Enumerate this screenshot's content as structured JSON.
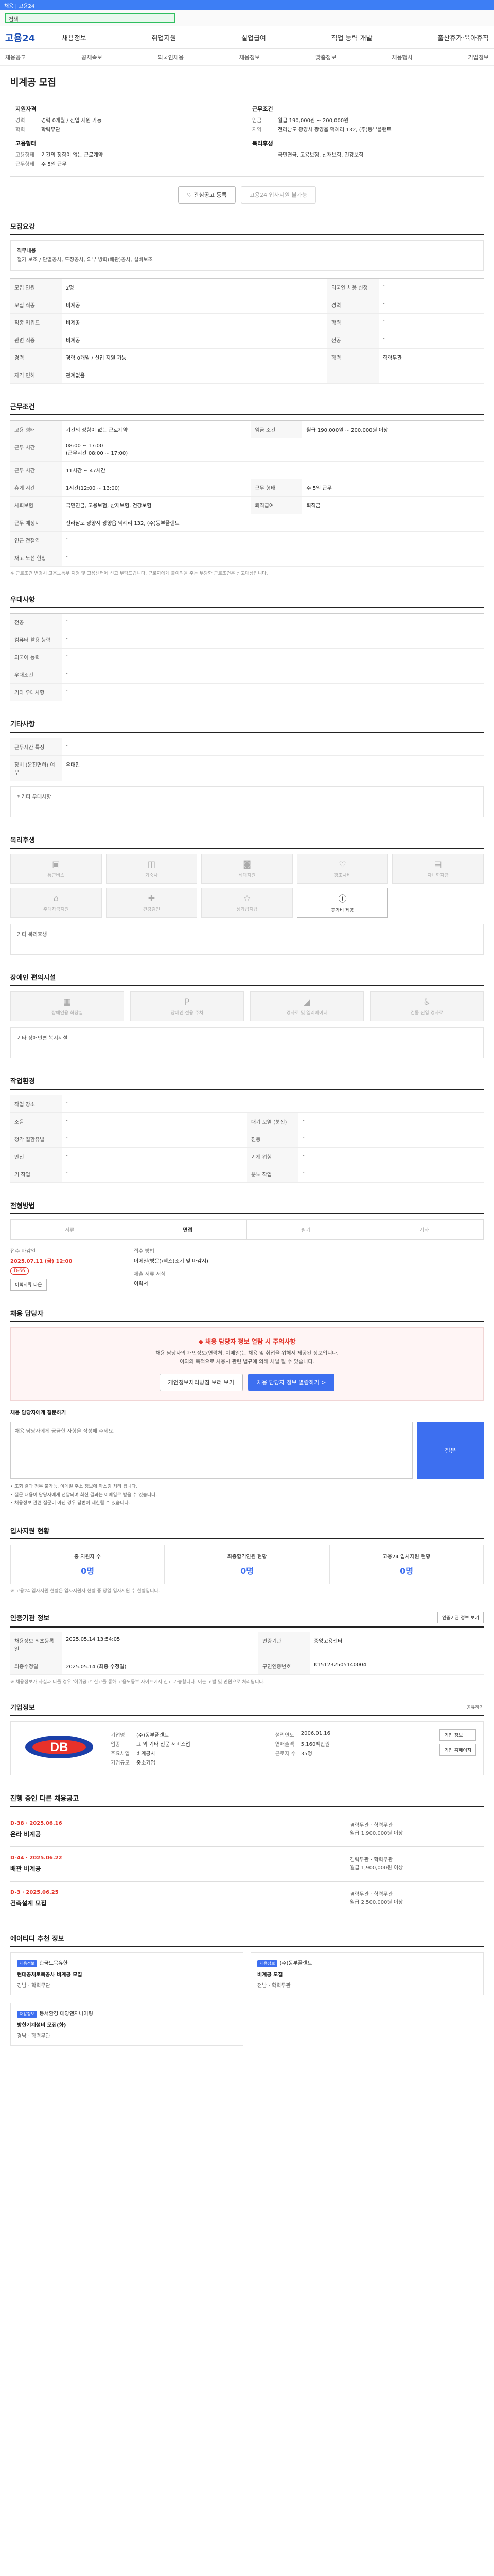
{
  "topbar": {
    "text": "채용 | 고용24"
  },
  "search": {
    "value": "검색"
  },
  "header": {
    "logo": "고용24",
    "menu": [
      "채용정보",
      "취업지원",
      "실업급여",
      "직업 능력 개발",
      "출산휴가·육아휴직"
    ]
  },
  "subnav": [
    "채용공고",
    "공채속보",
    "외국인채용",
    "채용정보",
    "맞춤정보",
    "채용행사",
    "기업정보"
  ],
  "job_title": "비계공 모집",
  "summary": {
    "left_label": "지원자격",
    "left_rows": [
      {
        "k": "경력",
        "v": "경력 0개월 / 신입 지원 가능"
      },
      {
        "k": "학력",
        "v": "학력무관"
      }
    ],
    "left_label2": "고용형태",
    "left_rows2": [
      {
        "k": "고용형태",
        "v": "기간의 정함이 없는 근로계약"
      },
      {
        "k": "근무형태",
        "v": "주 5일 근무"
      }
    ],
    "right_label": "근무조건",
    "right_rows": [
      {
        "k": "임금",
        "v": "월급 190,000원 ~ 200,000원"
      },
      {
        "k": "지역",
        "v": "전라남도 광양시 광양읍 덕례리 132, (주)동부플랜트"
      }
    ],
    "right_label2": "복리후생",
    "right_rows2": [
      {
        "k": "",
        "v": "국민연금, 고용보험, 산재보험, 건강보험"
      }
    ]
  },
  "buttons": {
    "interest": "♡ 관심공고 등록",
    "apply": "고용24 입사지원 불가능"
  },
  "sections": {
    "recruit": "모집요강",
    "conditions": "근무조건",
    "preference": "우대사항",
    "etc": "기타사항",
    "welfare": "복리후생",
    "disability": "장애인 편의시설",
    "environment": "작업환경",
    "method": "전형방법",
    "contact": "채용 담당자",
    "applicants": "입사지원 현황",
    "agency": "인증기관 정보",
    "company": "기업정보",
    "other_jobs": "진행 중인 다른 채용공고",
    "recommend": "에이티디 추천 정보"
  },
  "recruit_box": {
    "label": "직무내용",
    "text": "철거 보조 / 단열공사, 도장공사, 외부 방화(배관)공사, 설비보조"
  },
  "recruit_table": [
    {
      "h": "모집 인원",
      "v": "2명",
      "h2": "외국인 채용 신청",
      "v2": "-"
    },
    {
      "h": "모집 직종",
      "v": "비계공",
      "h2": "경력",
      "v2": "-"
    },
    {
      "h": "직종 키워드",
      "v": "비계공",
      "h2": "학력",
      "v2": "-"
    },
    {
      "h": "관련 직종",
      "v": "비계공",
      "h2": "전공",
      "v2": "-"
    },
    {
      "h": "경력",
      "v": "경력 0개월 / 신입 지원 가능",
      "h2": "학력",
      "v2": "학력무관"
    },
    {
      "h": "자격 면허",
      "v": "관계없음",
      "h2": "",
      "v2": ""
    }
  ],
  "cond_table": [
    {
      "h": "고용 형태",
      "v": "기간의 정함이 없는 근로계약",
      "h2": "임금 조건",
      "v2": "월급 190,000원 ~ 200,000원 이상"
    },
    {
      "h": "근무 시간",
      "v": "08:00 ~ 17:00\n(근무시간 08:00 ~ 17:00)"
    },
    {
      "h": "근무 시간",
      "v": "11시간 ~ 47시간"
    },
    {
      "h": "휴게 시간",
      "v": "1시간(12:00 ~ 13:00)",
      "h2": "근무 형태",
      "v2": "주 5일 근무"
    },
    {
      "h": "사회보험",
      "v": "국민연금, 고용보험, 산재보험, 건강보험",
      "h2": "퇴직급여",
      "v2": "퇴직금"
    },
    {
      "h": "근무 예정지",
      "v": "전라남도 광양시 광양읍 덕례리 132, (주)동부플랜트",
      "h2": "",
      "v2": ""
    },
    {
      "h": "인근 전철역",
      "v": "-",
      "h2": "",
      "v2": ""
    },
    {
      "h": "재고 노선 현황",
      "v": "-",
      "h2": "",
      "v2": ""
    }
  ],
  "cond_note": "※ 근로조건 변경시 고용노동부 지청 및 고용센터에 신고 부탁드립니다. 근로자에게 불이익을 주는 부당한 근로조건은 신고대상입니다.",
  "pref_table": [
    {
      "h": "전공",
      "v": "-"
    },
    {
      "h": "컴퓨터 활용 능력",
      "v": "-"
    },
    {
      "h": "외국어 능력",
      "v": "-"
    },
    {
      "h": "우대조건",
      "v": "-"
    },
    {
      "h": "기타 우대사항",
      "v": "-"
    }
  ],
  "etc_table": [
    {
      "h": "근무시간 특징",
      "v": "-"
    },
    {
      "h": "장비 (운전면허) 여부",
      "v": "우대안"
    }
  ],
  "etc_box": "* 기타 우대사항",
  "welfare_items": [
    {
      "icon": "briefcase-icon",
      "glyph": "▣",
      "label": "통근버스",
      "on": false
    },
    {
      "icon": "car-icon",
      "glyph": "◫",
      "label": "기숙사",
      "on": false
    },
    {
      "icon": "meal-icon",
      "glyph": "◙",
      "label": "식대지원",
      "on": false
    },
    {
      "icon": "heart-icon",
      "glyph": "♡",
      "label": "경조사비",
      "on": false
    },
    {
      "icon": "gift-icon",
      "glyph": "▤",
      "label": "자녀학자금",
      "on": false
    },
    {
      "icon": "home-icon",
      "glyph": "⌂",
      "label": "주택자금지원",
      "on": false
    },
    {
      "icon": "health-icon",
      "glyph": "✚",
      "label": "건강검진",
      "on": false
    },
    {
      "icon": "star-icon",
      "glyph": "☆",
      "label": "성과급지급",
      "on": false
    },
    {
      "icon": "info-icon",
      "glyph": "ⓘ",
      "label": "휴가비 제공",
      "on": true
    }
  ],
  "welfare_box": "기타 복리후생",
  "disability_items": [
    {
      "icon": "elevator-icon",
      "glyph": "▦",
      "label": "장애인용 화장실"
    },
    {
      "icon": "parking-icon",
      "glyph": "P",
      "label": "장애인 전용 주차"
    },
    {
      "icon": "ramp-icon",
      "glyph": "◢",
      "label": "경사로 및 엘리베이터"
    },
    {
      "icon": "wheelchair-icon",
      "glyph": "♿",
      "label": "건물 진입 경사로"
    }
  ],
  "disability_box": "기타 장애인편 복지시설",
  "env_table": [
    {
      "h": "작업 장소",
      "v": "-",
      "h2": "",
      "v2": ""
    },
    {
      "h": "소음",
      "v": "-",
      "h2": "대기 오염 (분진)",
      "v2": "-"
    },
    {
      "h": "청각 질환유발",
      "v": "-",
      "h2": "진동",
      "v2": "-"
    },
    {
      "h": "안전",
      "v": "-",
      "h2": "기계 위험",
      "v2": "-"
    },
    {
      "h": "기 작업",
      "v": "-",
      "h2": "분노 작업",
      "v2": "-"
    }
  ],
  "method_tabs": [
    "서류",
    "면접",
    "필기",
    "기타"
  ],
  "method_rows": {
    "deadline_label": "접수 마감일",
    "deadline": "2025.07.11 (금) 12:00",
    "tag": "D-66",
    "submit_label": "접수 방법",
    "submit_value": "이메일(방문)/팩스(조기 및 마감시)",
    "docs_label": "제출 서류 서식",
    "docs_value": "이력서",
    "docs_btn": "이력서류 다운"
  },
  "contact": {
    "title": "◆ 채용 담당자 정보 열람 시 주의사항",
    "lines": [
      "채용 담당자의 개인정보(연락처, 이메일)는 채용 및 취업을 위해서 제공된 정보입니다.",
      "이외의 목적으로 사용시 관련 법규에 의해 처벌 될 수 있습니다."
    ],
    "btn1": "개인정보처리방침 보러 보기",
    "btn2": "채용 담당자 정보 열람하기 >",
    "qa_label": "채용 담당자에게 질문하기",
    "qa_placeholder": "채용 담당자에게 궁금한 사항을 작성해 주세요.",
    "qa_submit": "질문",
    "bullets": [
      "• 조회 결과 첨부 불가능, 이메일 주소 정보에 마스킹 처리 됩니다.",
      "• 질문 내용이 담당자에게 전달되며 회신 결과는 이메일로 받을 수 있습니다.",
      "• 채용정보 관련 질문이 아닌 경우 답변이 제한될 수 있습니다."
    ]
  },
  "applicants": [
    {
      "label": "총 지원자 수",
      "n": "0명"
    },
    {
      "label": "최종합격인원 현황",
      "n": "0명"
    },
    {
      "label": "고용24 입사지원 현황",
      "n": "0명"
    }
  ],
  "applicants_note": "※ 고용24 입사지원 현황은 입사지원자 현황 중 당일 입사지원 수 현황입니다.",
  "agency_table": [
    {
      "h": "채용정보 최초등록일",
      "v": "2025.05.14 13:54:05",
      "h2": "인증기관",
      "v2": "중앙고용센터"
    },
    {
      "h": "최종수정일",
      "v": "2025.05.14 (최종 수정일)",
      "h2": "구인인증번호",
      "v2": "K151232505140004"
    }
  ],
  "agency_btn": "인증기관 정보 보기",
  "agency_notes": [
    "※ 채용정보가 사실과 다를 경우 '허위공고' 신고를 통해 고용노동부 사이트에서 신고 가능합니다. 이는 고발 및 민원으로 처리됩니다."
  ],
  "company": {
    "logo_text": "DB",
    "rows": [
      {
        "k": "기업명",
        "v": "(주)동부플랜트"
      },
      {
        "k": "업종",
        "v": "그 외 기타 전문 서비스업"
      },
      {
        "k": "주요사업",
        "v": "비계공사"
      },
      {
        "k": "기업규모",
        "v": "중소기업"
      }
    ],
    "rows2": [
      {
        "k": "설립연도",
        "v": "2006.01.16"
      },
      {
        "k": "연매출액",
        "v": "5,160백만원"
      },
      {
        "k": "근로자 수",
        "v": "35명"
      }
    ],
    "btns": [
      "기업 정보",
      "기업 홈페이지"
    ],
    "share": "공유하기"
  },
  "jobs": [
    {
      "d": "D-38 · 2025.06.16",
      "name": "온라 비계공",
      "meta": "경력무관 · 학력무관",
      "pay": "월급 1,900,000원 이상"
    },
    {
      "d": "D-44 · 2025.06.22",
      "name": "배관 비계공",
      "meta": "경력무관 · 학력무관",
      "pay": "월급 1,900,000원 이상"
    },
    {
      "d": "D-3 · 2025.06.25",
      "name": "건축설계 모집",
      "meta": "경력무관 · 학력무관",
      "pay": "월급 2,500,000원 이상"
    }
  ],
  "recos": [
    {
      "badge": "채용정보",
      "company": "한국토목유한",
      "title": "현대공채토목공사 비계공 모집",
      "region": "경남",
      "edu": "학력무관"
    },
    {
      "badge": "채용정보",
      "company": "(주)동부플랜트",
      "title": "비계공 모집",
      "region": "전남",
      "edu": "학력무관"
    },
    {
      "badge": "채용정보",
      "company": "동서환경 태양엔지니어링",
      "title": "방한기계설비 모집(화)",
      "region": "경남",
      "edu": "학력무관"
    }
  ],
  "colors": {
    "brand": "#3d6ff0",
    "deadline": "#e2342a"
  }
}
